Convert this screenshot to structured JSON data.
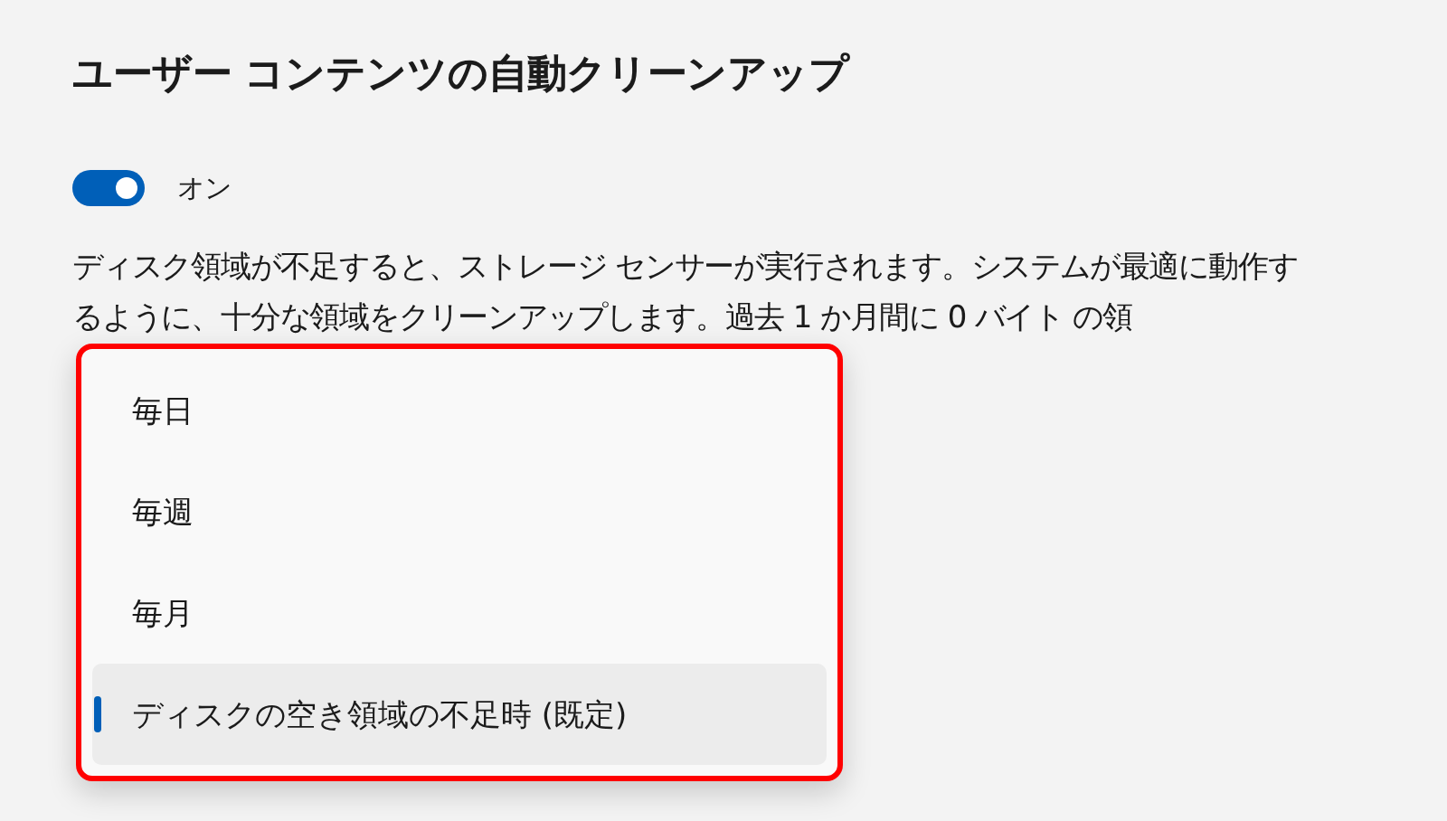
{
  "section": {
    "title": "ユーザー コンテンツの自動クリーンアップ",
    "toggle": {
      "on": true,
      "label": "オン"
    },
    "description": "ディスク領域が不足すると、ストレージ センサーが実行されます。システムが最適に動作するように、十分な領域をクリーンアップします。過去 1 か月間に 0 バイト の領"
  },
  "dropdown": {
    "highlighted": true,
    "options": [
      {
        "label": "毎日",
        "selected": false
      },
      {
        "label": "毎週",
        "selected": false
      },
      {
        "label": "毎月",
        "selected": false
      },
      {
        "label": "ディスクの空き領域の不足時 (既定)",
        "selected": true
      }
    ]
  }
}
